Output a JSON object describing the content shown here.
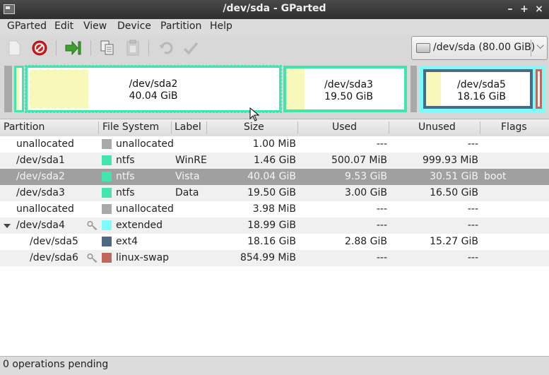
{
  "window": {
    "title": "/dev/sda - GParted",
    "minimize": "–",
    "maximize": "+",
    "close": "×"
  },
  "menu": [
    "GParted",
    "Edit",
    "View",
    "Device",
    "Partition",
    "Help"
  ],
  "toolbar": {
    "icons": [
      "new-icon",
      "delete-icon",
      "resize-move-icon",
      "copy-icon",
      "paste-icon",
      "undo-icon",
      "apply-icon"
    ]
  },
  "device_selector": {
    "label": "/dev/sda  (80.00 GiB)"
  },
  "disk_map": {
    "sda2": {
      "name": "/dev/sda2",
      "size": "40.04 GiB"
    },
    "sda3": {
      "name": "/dev/sda3",
      "size": "19.50 GiB"
    },
    "sda5": {
      "name": "/dev/sda5",
      "size": "18.16 GiB"
    }
  },
  "columns": [
    "Partition",
    "File System",
    "Label",
    "Size",
    "Used",
    "Unused",
    "Flags"
  ],
  "rows": [
    {
      "partition": "unallocated",
      "fs": "unallocated",
      "label": "",
      "size": "1.00 MiB",
      "used": "---",
      "unused": "---",
      "flags": ""
    },
    {
      "partition": "/dev/sda1",
      "fs": "ntfs",
      "label": "WinRE",
      "size": "1.46 GiB",
      "used": "500.07 MiB",
      "unused": "999.93 MiB",
      "flags": ""
    },
    {
      "partition": "/dev/sda2",
      "fs": "ntfs",
      "label": "Vista",
      "size": "40.04 GiB",
      "used": "9.53 GiB",
      "unused": "30.51 GiB",
      "flags": "boot"
    },
    {
      "partition": "/dev/sda3",
      "fs": "ntfs",
      "label": "Data",
      "size": "19.50 GiB",
      "used": "3.00 GiB",
      "unused": "16.50 GiB",
      "flags": ""
    },
    {
      "partition": "unallocated",
      "fs": "unallocated",
      "label": "",
      "size": "3.98 MiB",
      "used": "---",
      "unused": "---",
      "flags": ""
    },
    {
      "partition": "/dev/sda4",
      "fs": "extended",
      "label": "",
      "size": "18.99 GiB",
      "used": "---",
      "unused": "---",
      "flags": ""
    },
    {
      "partition": "/dev/sda5",
      "fs": "ext4",
      "label": "",
      "size": "18.16 GiB",
      "used": "2.88 GiB",
      "unused": "15.27 GiB",
      "flags": ""
    },
    {
      "partition": "/dev/sda6",
      "fs": "linux-swap",
      "label": "",
      "size": "854.99 MiB",
      "used": "---",
      "unused": "---",
      "flags": ""
    }
  ],
  "colors": {
    "unallocated": "#a9a9a9",
    "ntfs": "#42e5ac",
    "extended": "#7dfcfe",
    "ext4": "#4b6983",
    "linux_swap": "#c1665a",
    "used_fill": "#f8f8ba",
    "selected_row": "#a0a0a0"
  },
  "status": {
    "text": "0 operations pending"
  }
}
